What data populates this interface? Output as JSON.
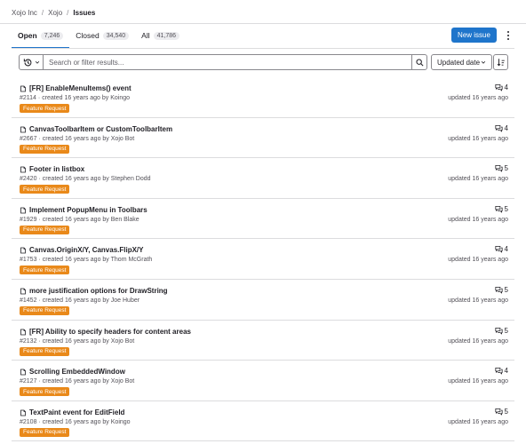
{
  "breadcrumb": {
    "items": [
      "Xojo Inc",
      "Xojo",
      "Issues"
    ]
  },
  "tabs": [
    {
      "label": "Open",
      "count": "7,246"
    },
    {
      "label": "Closed",
      "count": "34,540"
    },
    {
      "label": "All",
      "count": "41,786"
    }
  ],
  "actions": {
    "new_issue": "New issue",
    "more_icon": "kebab-vertical-icon"
  },
  "filter": {
    "placeholder": "Search or filter results...",
    "value": "",
    "history_icon": "history-icon",
    "search_icon": "search-icon"
  },
  "sort": {
    "selected": "Updated date",
    "direction_icon": "sort-lowest-icon"
  },
  "colors": {
    "accent": "#1f75cb",
    "label": "#e9891a"
  },
  "issues": [
    {
      "title": "[FR] EnableMenuItems() event",
      "number": "#2114",
      "created": "created 16 years ago by",
      "author": "Koingo",
      "label": "Feature Request",
      "comments": "4",
      "updated": "updated 16 years ago"
    },
    {
      "title": "CanvasToolbarItem or CustomToolbarItem",
      "number": "#2667",
      "created": "created 16 years ago by",
      "author": "Xojo Bot",
      "label": "Feature Request",
      "comments": "4",
      "updated": "updated 16 years ago"
    },
    {
      "title": "Footer in listbox",
      "number": "#2420",
      "created": "created 16 years ago by",
      "author": "Stephen Dodd",
      "label": "Feature Request",
      "comments": "5",
      "updated": "updated 16 years ago"
    },
    {
      "title": "Implement PopupMenu in Toolbars",
      "number": "#1929",
      "created": "created 16 years ago by",
      "author": "Ben Blake",
      "label": "Feature Request",
      "comments": "5",
      "updated": "updated 16 years ago"
    },
    {
      "title": "Canvas.OriginX/Y, Canvas.FlipX/Y",
      "number": "#1753",
      "created": "created 16 years ago by",
      "author": "Thom McGrath",
      "label": "Feature Request",
      "comments": "4",
      "updated": "updated 16 years ago"
    },
    {
      "title": "more justification options for DrawString",
      "number": "#1452",
      "created": "created 16 years ago by",
      "author": "Joe Huber",
      "label": "Feature Request",
      "comments": "5",
      "updated": "updated 16 years ago"
    },
    {
      "title": "[FR] Ability to specify headers for content areas",
      "number": "#2132",
      "created": "created 16 years ago by",
      "author": "Xojo Bot",
      "label": "Feature Request",
      "comments": "5",
      "updated": "updated 16 years ago"
    },
    {
      "title": "Scrolling EmbeddedWindow",
      "number": "#2127",
      "created": "created 16 years ago by",
      "author": "Xojo Bot",
      "label": "Feature Request",
      "comments": "4",
      "updated": "updated 16 years ago"
    },
    {
      "title": "TextPaint event for EditField",
      "number": "#2108",
      "created": "created 16 years ago by",
      "author": "Koingo",
      "label": "Feature Request",
      "comments": "5",
      "updated": "updated 16 years ago"
    }
  ]
}
